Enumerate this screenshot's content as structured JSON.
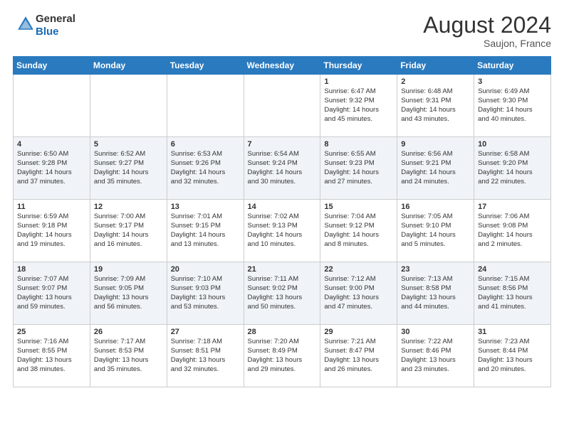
{
  "header": {
    "logo_line1": "General",
    "logo_line2": "Blue",
    "month": "August 2024",
    "location": "Saujon, France"
  },
  "weekdays": [
    "Sunday",
    "Monday",
    "Tuesday",
    "Wednesday",
    "Thursday",
    "Friday",
    "Saturday"
  ],
  "weeks": [
    [
      {
        "day": "",
        "info": ""
      },
      {
        "day": "",
        "info": ""
      },
      {
        "day": "",
        "info": ""
      },
      {
        "day": "",
        "info": ""
      },
      {
        "day": "1",
        "info": "Sunrise: 6:47 AM\nSunset: 9:32 PM\nDaylight: 14 hours\nand 45 minutes."
      },
      {
        "day": "2",
        "info": "Sunrise: 6:48 AM\nSunset: 9:31 PM\nDaylight: 14 hours\nand 43 minutes."
      },
      {
        "day": "3",
        "info": "Sunrise: 6:49 AM\nSunset: 9:30 PM\nDaylight: 14 hours\nand 40 minutes."
      }
    ],
    [
      {
        "day": "4",
        "info": "Sunrise: 6:50 AM\nSunset: 9:28 PM\nDaylight: 14 hours\nand 37 minutes."
      },
      {
        "day": "5",
        "info": "Sunrise: 6:52 AM\nSunset: 9:27 PM\nDaylight: 14 hours\nand 35 minutes."
      },
      {
        "day": "6",
        "info": "Sunrise: 6:53 AM\nSunset: 9:26 PM\nDaylight: 14 hours\nand 32 minutes."
      },
      {
        "day": "7",
        "info": "Sunrise: 6:54 AM\nSunset: 9:24 PM\nDaylight: 14 hours\nand 30 minutes."
      },
      {
        "day": "8",
        "info": "Sunrise: 6:55 AM\nSunset: 9:23 PM\nDaylight: 14 hours\nand 27 minutes."
      },
      {
        "day": "9",
        "info": "Sunrise: 6:56 AM\nSunset: 9:21 PM\nDaylight: 14 hours\nand 24 minutes."
      },
      {
        "day": "10",
        "info": "Sunrise: 6:58 AM\nSunset: 9:20 PM\nDaylight: 14 hours\nand 22 minutes."
      }
    ],
    [
      {
        "day": "11",
        "info": "Sunrise: 6:59 AM\nSunset: 9:18 PM\nDaylight: 14 hours\nand 19 minutes."
      },
      {
        "day": "12",
        "info": "Sunrise: 7:00 AM\nSunset: 9:17 PM\nDaylight: 14 hours\nand 16 minutes."
      },
      {
        "day": "13",
        "info": "Sunrise: 7:01 AM\nSunset: 9:15 PM\nDaylight: 14 hours\nand 13 minutes."
      },
      {
        "day": "14",
        "info": "Sunrise: 7:02 AM\nSunset: 9:13 PM\nDaylight: 14 hours\nand 10 minutes."
      },
      {
        "day": "15",
        "info": "Sunrise: 7:04 AM\nSunset: 9:12 PM\nDaylight: 14 hours\nand 8 minutes."
      },
      {
        "day": "16",
        "info": "Sunrise: 7:05 AM\nSunset: 9:10 PM\nDaylight: 14 hours\nand 5 minutes."
      },
      {
        "day": "17",
        "info": "Sunrise: 7:06 AM\nSunset: 9:08 PM\nDaylight: 14 hours\nand 2 minutes."
      }
    ],
    [
      {
        "day": "18",
        "info": "Sunrise: 7:07 AM\nSunset: 9:07 PM\nDaylight: 13 hours\nand 59 minutes."
      },
      {
        "day": "19",
        "info": "Sunrise: 7:09 AM\nSunset: 9:05 PM\nDaylight: 13 hours\nand 56 minutes."
      },
      {
        "day": "20",
        "info": "Sunrise: 7:10 AM\nSunset: 9:03 PM\nDaylight: 13 hours\nand 53 minutes."
      },
      {
        "day": "21",
        "info": "Sunrise: 7:11 AM\nSunset: 9:02 PM\nDaylight: 13 hours\nand 50 minutes."
      },
      {
        "day": "22",
        "info": "Sunrise: 7:12 AM\nSunset: 9:00 PM\nDaylight: 13 hours\nand 47 minutes."
      },
      {
        "day": "23",
        "info": "Sunrise: 7:13 AM\nSunset: 8:58 PM\nDaylight: 13 hours\nand 44 minutes."
      },
      {
        "day": "24",
        "info": "Sunrise: 7:15 AM\nSunset: 8:56 PM\nDaylight: 13 hours\nand 41 minutes."
      }
    ],
    [
      {
        "day": "25",
        "info": "Sunrise: 7:16 AM\nSunset: 8:55 PM\nDaylight: 13 hours\nand 38 minutes."
      },
      {
        "day": "26",
        "info": "Sunrise: 7:17 AM\nSunset: 8:53 PM\nDaylight: 13 hours\nand 35 minutes."
      },
      {
        "day": "27",
        "info": "Sunrise: 7:18 AM\nSunset: 8:51 PM\nDaylight: 13 hours\nand 32 minutes."
      },
      {
        "day": "28",
        "info": "Sunrise: 7:20 AM\nSunset: 8:49 PM\nDaylight: 13 hours\nand 29 minutes."
      },
      {
        "day": "29",
        "info": "Sunrise: 7:21 AM\nSunset: 8:47 PM\nDaylight: 13 hours\nand 26 minutes."
      },
      {
        "day": "30",
        "info": "Sunrise: 7:22 AM\nSunset: 8:46 PM\nDaylight: 13 hours\nand 23 minutes."
      },
      {
        "day": "31",
        "info": "Sunrise: 7:23 AM\nSunset: 8:44 PM\nDaylight: 13 hours\nand 20 minutes."
      }
    ]
  ]
}
